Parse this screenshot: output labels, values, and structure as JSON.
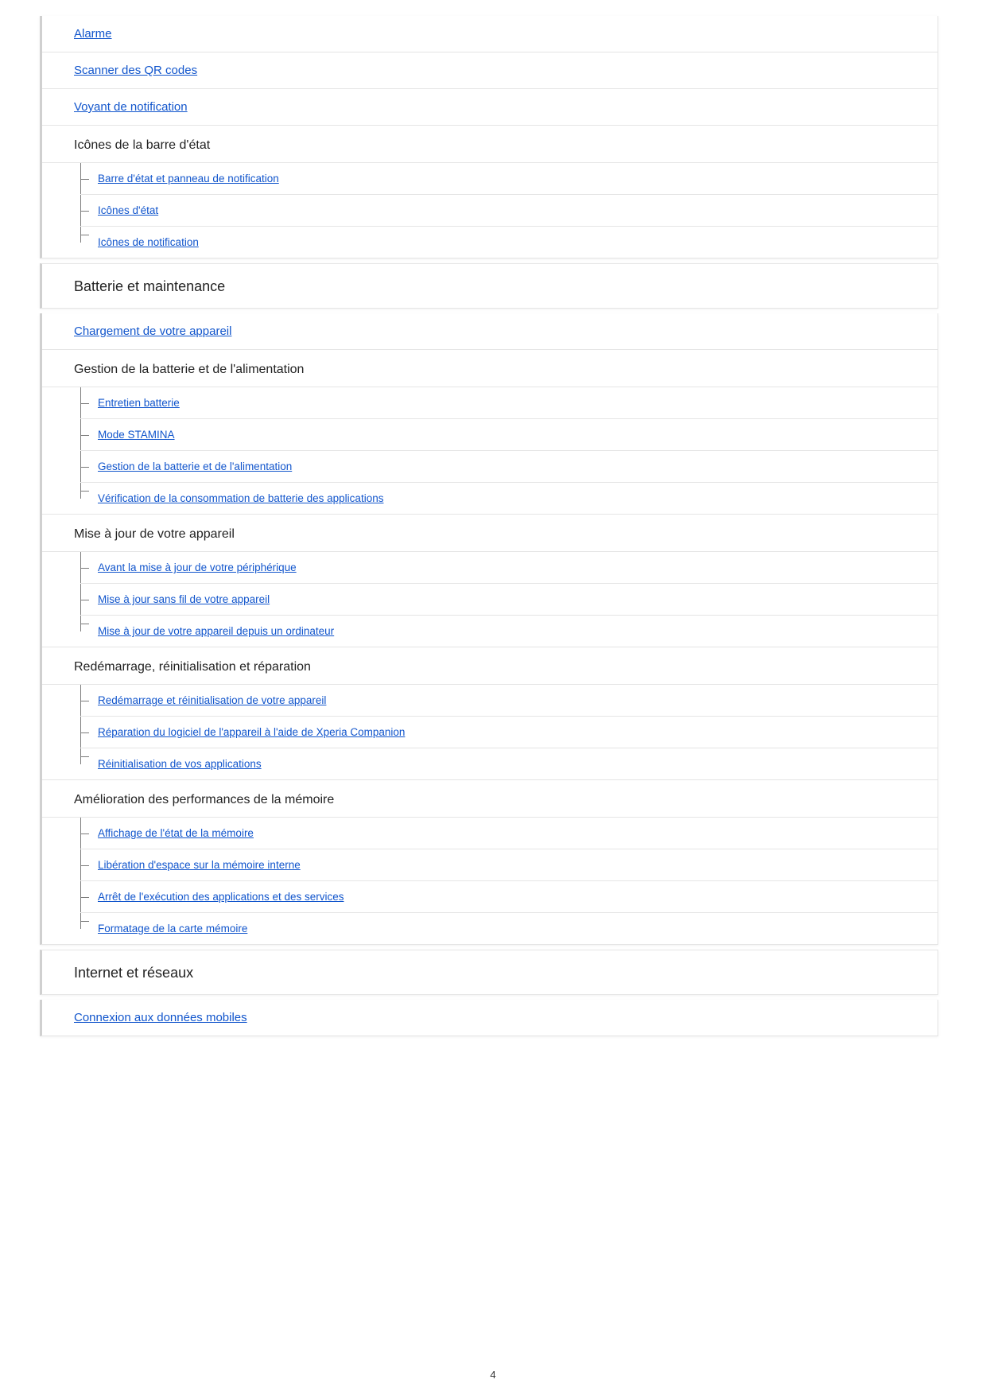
{
  "page_number": "4",
  "top_card": {
    "links": [
      "Alarme",
      "Scanner des QR codes",
      "Voyant de notification"
    ],
    "group_title": "Icônes de la barre d'état",
    "sub_links": [
      "Barre d'état et panneau de notification",
      "Icônes d'état",
      "Icônes de notification"
    ]
  },
  "battery_section": {
    "title": "Batterie et maintenance",
    "link_top": "Chargement de votre appareil",
    "group1": {
      "title": "Gestion de la batterie et de l'alimentation",
      "links": [
        "Entretien batterie",
        "Mode STAMINA",
        "Gestion de la batterie et de l'alimentation",
        "Vérification de la consommation de batterie des applications"
      ]
    },
    "group2": {
      "title": "Mise à jour de votre appareil",
      "links": [
        "Avant la mise à jour de votre périphérique",
        "Mise à jour sans fil de votre appareil",
        "Mise à jour de votre appareil depuis un ordinateur"
      ]
    },
    "group3": {
      "title": "Redémarrage, réinitialisation et réparation",
      "links": [
        "Redémarrage et réinitialisation de votre appareil",
        "Réparation du logiciel de l'appareil à l'aide de Xperia Companion",
        "Réinitialisation de vos applications"
      ]
    },
    "group4": {
      "title": "Amélioration des performances de la mémoire",
      "links": [
        "Affichage de l'état de la mémoire",
        "Libération d'espace sur la mémoire interne",
        "Arrêt de l'exécution des applications et des services",
        "Formatage de la carte mémoire"
      ]
    }
  },
  "internet_section": {
    "title": "Internet et réseaux",
    "link_top": "Connexion aux données mobiles"
  }
}
